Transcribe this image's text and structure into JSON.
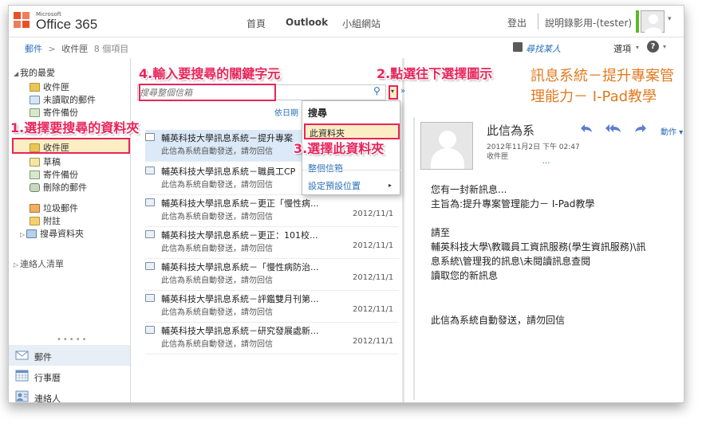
{
  "header": {
    "logo_brand": "Microsoft",
    "logo_product": "Office 365",
    "nav": [
      "首頁",
      "Outlook",
      "小組網站"
    ],
    "signout": "登出",
    "user": "說明錄影用-(tester)"
  },
  "subbar": {
    "mail": "郵件",
    "sep": ">",
    "folder": "收件匣",
    "count": "8 個項目",
    "find_people": "尋找某人",
    "options": "選項",
    "help": "?"
  },
  "folders": {
    "favorites_title": "我的最愛",
    "favorites": [
      "收件匣",
      "未讀取的郵件",
      "寄件備份"
    ],
    "main": [
      "收件匣",
      "草稿",
      "寄件備份",
      "刪除的郵件"
    ],
    "other": [
      "垃圾郵件",
      "附註",
      "搜尋資料夾"
    ],
    "contacts_list": "連絡人清單"
  },
  "bottom_nav": [
    "郵件",
    "行事曆",
    "連絡人"
  ],
  "search": {
    "placeholder": "搜尋整個信箱",
    "sort_label": "依日期"
  },
  "dropdown": {
    "title": "搜尋",
    "items": [
      "此資料夾",
      "整個信箱",
      "設定預設位置"
    ]
  },
  "messages": [
    {
      "from": "輔英科技大學訊息系統－提升專案",
      "preview": "此信為系統自動發送，請勿回信",
      "date": ""
    },
    {
      "from": "輔英科技大學訊息系統－職員工CP",
      "preview": "此信為系統自動發送，請勿回信",
      "date": ""
    },
    {
      "from": "輔英科技大學訊息系統－更正「慢性病...",
      "preview": "此信為系統自動發送，請勿回信",
      "date": "2012/11/1"
    },
    {
      "from": "輔英科技大學訊息系統－更正：101校...",
      "preview": "此信為系統自動發送，請勿回信",
      "date": "2012/11/1"
    },
    {
      "from": "輔英科技大學訊息系統－「慢性病防治...",
      "preview": "此信為系統自動發送，請勿回信",
      "date": "2012/11/1"
    },
    {
      "from": "輔英科技大學訊息系統－評鑑雙月刊第...",
      "preview": "此信為系統自動發送，請勿回信",
      "date": "2012/11/1"
    },
    {
      "from": "輔英科技大學訊息系統－研究發展處新...",
      "preview": "此信為系統自動發送，請勿回信",
      "date": "2012/11/1"
    }
  ],
  "reading": {
    "subject": "訊息系統－提升專案管理能力－ I-Pad教學",
    "sender": "此信為系",
    "date": "2012年11月2日 下午 02:47",
    "folder": "收件匣",
    "more": "...",
    "actions": "動作",
    "body": [
      "您有一封新訊息...",
      "主旨為:提升專案管理能力－ I-Pad教學",
      "請至",
      "輔英科技大學\\教職員工資訊服務(學生資訊服務)\\訊",
      "息系統\\管理我的訊息\\未閱讀訊息查閱",
      "讀取您的新訊息",
      "此信為系統自動發送，請勿回信"
    ]
  },
  "callouts": {
    "step1": "1.選擇要搜尋的資料夾",
    "step2": "2.點選往下選擇圖示",
    "step3": "3.選擇此資料夾",
    "step4": "4.輸入要搜尋的關鍵字元"
  },
  "colors": {
    "annotation": "#e8245b",
    "highlight": "#fbeec4",
    "link": "#2a6fb8",
    "subject": "#e07a20"
  }
}
